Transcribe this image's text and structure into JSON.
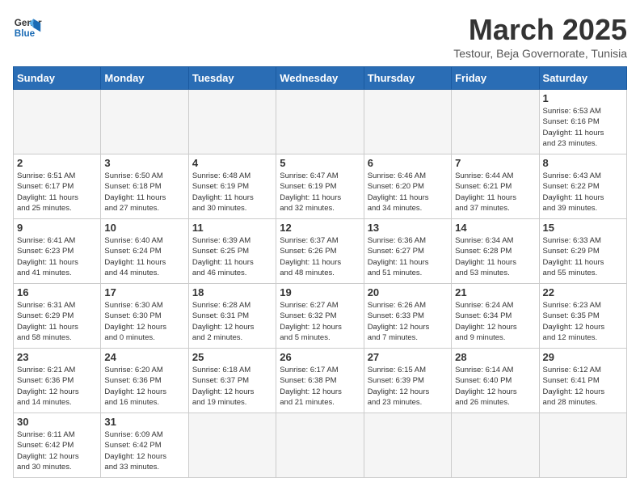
{
  "logo": {
    "line1": "General",
    "line2": "Blue"
  },
  "title": "March 2025",
  "subtitle": "Testour, Beja Governorate, Tunisia",
  "days_header": [
    "Sunday",
    "Monday",
    "Tuesday",
    "Wednesday",
    "Thursday",
    "Friday",
    "Saturday"
  ],
  "weeks": [
    [
      {
        "day": "",
        "info": ""
      },
      {
        "day": "",
        "info": ""
      },
      {
        "day": "",
        "info": ""
      },
      {
        "day": "",
        "info": ""
      },
      {
        "day": "",
        "info": ""
      },
      {
        "day": "",
        "info": ""
      },
      {
        "day": "1",
        "info": "Sunrise: 6:53 AM\nSunset: 6:16 PM\nDaylight: 11 hours\nand 23 minutes."
      }
    ],
    [
      {
        "day": "2",
        "info": "Sunrise: 6:51 AM\nSunset: 6:17 PM\nDaylight: 11 hours\nand 25 minutes."
      },
      {
        "day": "3",
        "info": "Sunrise: 6:50 AM\nSunset: 6:18 PM\nDaylight: 11 hours\nand 27 minutes."
      },
      {
        "day": "4",
        "info": "Sunrise: 6:48 AM\nSunset: 6:19 PM\nDaylight: 11 hours\nand 30 minutes."
      },
      {
        "day": "5",
        "info": "Sunrise: 6:47 AM\nSunset: 6:19 PM\nDaylight: 11 hours\nand 32 minutes."
      },
      {
        "day": "6",
        "info": "Sunrise: 6:46 AM\nSunset: 6:20 PM\nDaylight: 11 hours\nand 34 minutes."
      },
      {
        "day": "7",
        "info": "Sunrise: 6:44 AM\nSunset: 6:21 PM\nDaylight: 11 hours\nand 37 minutes."
      },
      {
        "day": "8",
        "info": "Sunrise: 6:43 AM\nSunset: 6:22 PM\nDaylight: 11 hours\nand 39 minutes."
      }
    ],
    [
      {
        "day": "9",
        "info": "Sunrise: 6:41 AM\nSunset: 6:23 PM\nDaylight: 11 hours\nand 41 minutes."
      },
      {
        "day": "10",
        "info": "Sunrise: 6:40 AM\nSunset: 6:24 PM\nDaylight: 11 hours\nand 44 minutes."
      },
      {
        "day": "11",
        "info": "Sunrise: 6:39 AM\nSunset: 6:25 PM\nDaylight: 11 hours\nand 46 minutes."
      },
      {
        "day": "12",
        "info": "Sunrise: 6:37 AM\nSunset: 6:26 PM\nDaylight: 11 hours\nand 48 minutes."
      },
      {
        "day": "13",
        "info": "Sunrise: 6:36 AM\nSunset: 6:27 PM\nDaylight: 11 hours\nand 51 minutes."
      },
      {
        "day": "14",
        "info": "Sunrise: 6:34 AM\nSunset: 6:28 PM\nDaylight: 11 hours\nand 53 minutes."
      },
      {
        "day": "15",
        "info": "Sunrise: 6:33 AM\nSunset: 6:29 PM\nDaylight: 11 hours\nand 55 minutes."
      }
    ],
    [
      {
        "day": "16",
        "info": "Sunrise: 6:31 AM\nSunset: 6:29 PM\nDaylight: 11 hours\nand 58 minutes."
      },
      {
        "day": "17",
        "info": "Sunrise: 6:30 AM\nSunset: 6:30 PM\nDaylight: 12 hours\nand 0 minutes."
      },
      {
        "day": "18",
        "info": "Sunrise: 6:28 AM\nSunset: 6:31 PM\nDaylight: 12 hours\nand 2 minutes."
      },
      {
        "day": "19",
        "info": "Sunrise: 6:27 AM\nSunset: 6:32 PM\nDaylight: 12 hours\nand 5 minutes."
      },
      {
        "day": "20",
        "info": "Sunrise: 6:26 AM\nSunset: 6:33 PM\nDaylight: 12 hours\nand 7 minutes."
      },
      {
        "day": "21",
        "info": "Sunrise: 6:24 AM\nSunset: 6:34 PM\nDaylight: 12 hours\nand 9 minutes."
      },
      {
        "day": "22",
        "info": "Sunrise: 6:23 AM\nSunset: 6:35 PM\nDaylight: 12 hours\nand 12 minutes."
      }
    ],
    [
      {
        "day": "23",
        "info": "Sunrise: 6:21 AM\nSunset: 6:36 PM\nDaylight: 12 hours\nand 14 minutes."
      },
      {
        "day": "24",
        "info": "Sunrise: 6:20 AM\nSunset: 6:36 PM\nDaylight: 12 hours\nand 16 minutes."
      },
      {
        "day": "25",
        "info": "Sunrise: 6:18 AM\nSunset: 6:37 PM\nDaylight: 12 hours\nand 19 minutes."
      },
      {
        "day": "26",
        "info": "Sunrise: 6:17 AM\nSunset: 6:38 PM\nDaylight: 12 hours\nand 21 minutes."
      },
      {
        "day": "27",
        "info": "Sunrise: 6:15 AM\nSunset: 6:39 PM\nDaylight: 12 hours\nand 23 minutes."
      },
      {
        "day": "28",
        "info": "Sunrise: 6:14 AM\nSunset: 6:40 PM\nDaylight: 12 hours\nand 26 minutes."
      },
      {
        "day": "29",
        "info": "Sunrise: 6:12 AM\nSunset: 6:41 PM\nDaylight: 12 hours\nand 28 minutes."
      }
    ],
    [
      {
        "day": "30",
        "info": "Sunrise: 6:11 AM\nSunset: 6:42 PM\nDaylight: 12 hours\nand 30 minutes."
      },
      {
        "day": "31",
        "info": "Sunrise: 6:09 AM\nSunset: 6:42 PM\nDaylight: 12 hours\nand 33 minutes."
      },
      {
        "day": "",
        "info": ""
      },
      {
        "day": "",
        "info": ""
      },
      {
        "day": "",
        "info": ""
      },
      {
        "day": "",
        "info": ""
      },
      {
        "day": "",
        "info": ""
      }
    ]
  ]
}
